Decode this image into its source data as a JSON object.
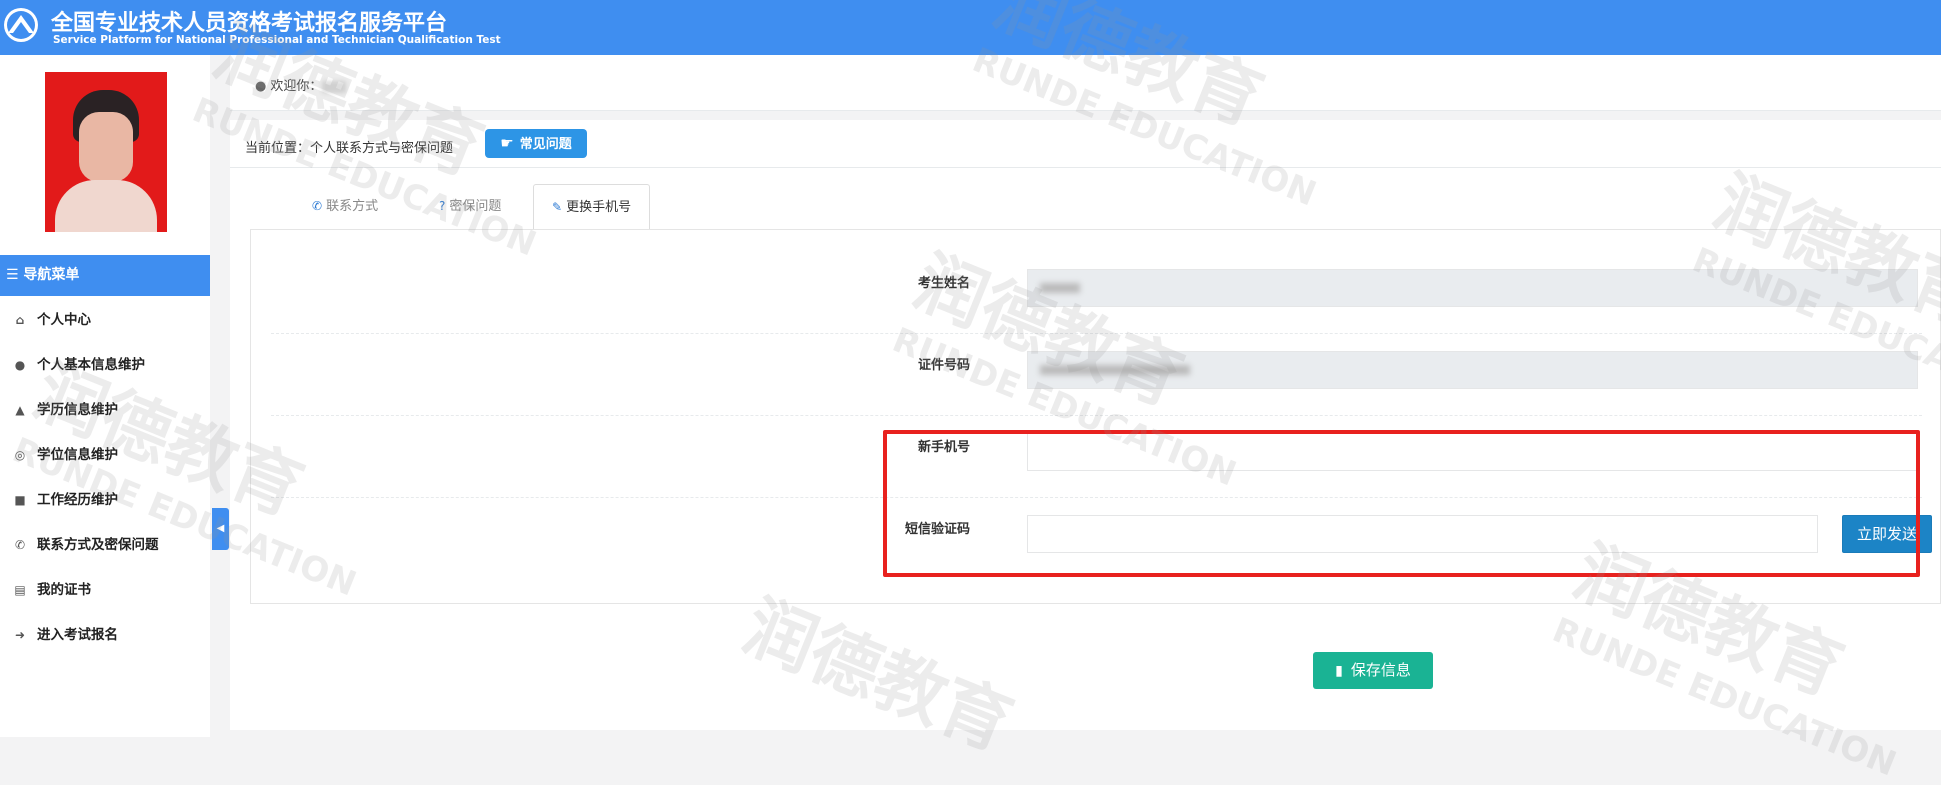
{
  "header": {
    "title_cn": "全国专业技术人员资格考试报名服务平台",
    "title_en": "Service Platform for National Professional and Technician Qualification Test",
    "logo_icon": "pta-logo-icon"
  },
  "topbar": {
    "welcome_label": "欢迎你："
  },
  "sidebar": {
    "nav_header": "☰ 导航菜单",
    "items": [
      {
        "label": "个人中心",
        "icon": "home-icon",
        "glyph": "⌂"
      },
      {
        "label": "个人基本信息维护",
        "icon": "user-icon",
        "glyph": "●"
      },
      {
        "label": "学历信息维护",
        "icon": "graduation-cap-icon",
        "glyph": "▲"
      },
      {
        "label": "学位信息维护",
        "icon": "medal-icon",
        "glyph": "◎"
      },
      {
        "label": "工作经历维护",
        "icon": "briefcase-icon",
        "glyph": "■"
      },
      {
        "label": "联系方式及密保问题",
        "icon": "phone-icon",
        "glyph": "✆"
      },
      {
        "label": "我的证书",
        "icon": "book-icon",
        "glyph": "▤"
      },
      {
        "label": "进入考试报名",
        "icon": "arrow-circle-icon",
        "glyph": "➜"
      }
    ]
  },
  "breadcrumb": {
    "text": "当前位置：个人联系方式与密保问题",
    "faq_button": "常见问题"
  },
  "tabs": [
    {
      "label": "联系方式",
      "glyph": "✆"
    },
    {
      "label": "密保问题",
      "glyph": "?"
    },
    {
      "label": "更换手机号",
      "glyph": "✎"
    }
  ],
  "form": {
    "name_label": "考生姓名",
    "id_label": "证件号码",
    "new_phone_label": "新手机号",
    "sms_label": "短信验证码",
    "send_button": "立即发送",
    "save_button": "保存信息"
  },
  "watermark": {
    "cn": "润德教育",
    "en": "RUNDE EDUCATION"
  },
  "colors": {
    "header": "#3f8ef0",
    "highlight": "#e8211e",
    "save": "#1ab394",
    "send": "#1c84c6"
  }
}
